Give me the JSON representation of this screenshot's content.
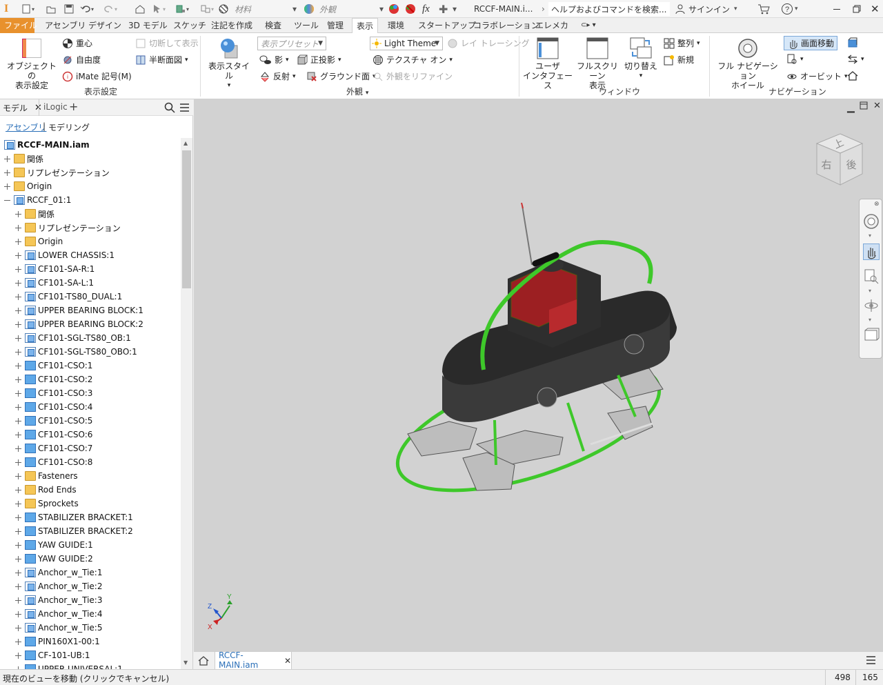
{
  "titlebar": {
    "materials_label": "材料",
    "appearance_label": "外観",
    "document_title": "RCCF-MAIN.i...",
    "search_placeholder": "ヘルプおよびコマンドを検索...",
    "signin_label": "サインイン"
  },
  "ribbon_tabs": [
    "ファイル",
    "アセンブリ",
    "デザイン",
    "3D モデル",
    "スケッチ",
    "注記を作成",
    "検査",
    "ツール",
    "管理",
    "表示",
    "環境",
    "スタートアップ",
    "コラボレーション",
    "エレメカ"
  ],
  "ribbon": {
    "object_visibility": "オブジェクトの\n表示設定",
    "center_of_gravity": "重心",
    "dof": "自由度",
    "imate_glyph": "iMate 記号(M)",
    "visibility_group": "表示設定",
    "cut_display": "切断して表示",
    "half_section": "半断面図",
    "visual_style": "表示スタイル",
    "view_preset": "表示プリセット",
    "light_theme": "Light Theme",
    "ray_tracing": "レイ トレーシング",
    "shadow": "影",
    "orthographic": "正投影",
    "texture_on": "テクスチャ オン",
    "reflection": "反射",
    "ground_plane": "グラウンド面",
    "refine_appearance": "外観をリファイン",
    "appearance_group": "外観",
    "user_interface": "ユーザ\nインタフェース",
    "full_screen": "フルスクリーン\n表示",
    "switch": "切り替え",
    "arrange": "整列",
    "new_window": "新規",
    "window_group": "ウィンドウ",
    "full_nav_wheel": "フル ナビゲーション\nホイール",
    "pan": "画面移動",
    "orbit": "オービット",
    "navigation_group": "ナビゲーション"
  },
  "browser": {
    "tab_model": "モデル",
    "tab_ilogic": "iLogic",
    "sub_assembly": "アセンブリ",
    "sub_modeling": "モデリング",
    "root": "RCCF-MAIN.iam",
    "items": [
      {
        "label": "関係",
        "icon": "folder",
        "indent": 0,
        "exp": "plus"
      },
      {
        "label": "リプレゼンテーション",
        "icon": "folder",
        "indent": 0,
        "exp": "plus"
      },
      {
        "label": "Origin",
        "icon": "folder",
        "indent": 0,
        "exp": "plus"
      },
      {
        "label": "RCCF_01:1",
        "icon": "asm",
        "indent": 0,
        "exp": "minus"
      },
      {
        "label": "関係",
        "icon": "folder",
        "indent": 1,
        "exp": "plus"
      },
      {
        "label": "リプレゼンテーション",
        "icon": "folder",
        "indent": 1,
        "exp": "plus"
      },
      {
        "label": "Origin",
        "icon": "folder",
        "indent": 1,
        "exp": "plus"
      },
      {
        "label": "LOWER CHASSIS:1",
        "icon": "asm",
        "indent": 1,
        "exp": "plus"
      },
      {
        "label": "CF101-SA-R:1",
        "icon": "asm",
        "indent": 1,
        "exp": "plus"
      },
      {
        "label": "CF101-SA-L:1",
        "icon": "asm",
        "indent": 1,
        "exp": "plus"
      },
      {
        "label": "CF101-TS80_DUAL:1",
        "icon": "asm",
        "indent": 1,
        "exp": "plus"
      },
      {
        "label": "UPPER BEARING BLOCK:1",
        "icon": "asm",
        "indent": 1,
        "exp": "plus"
      },
      {
        "label": "UPPER BEARING BLOCK:2",
        "icon": "asm",
        "indent": 1,
        "exp": "plus"
      },
      {
        "label": "CF101-SGL-TS80_OB:1",
        "icon": "asm",
        "indent": 1,
        "exp": "plus"
      },
      {
        "label": "CF101-SGL-TS80_OBO:1",
        "icon": "asm",
        "indent": 1,
        "exp": "plus"
      },
      {
        "label": "CF101-CSO:1",
        "icon": "part",
        "indent": 1,
        "exp": "plus"
      },
      {
        "label": "CF101-CSO:2",
        "icon": "part",
        "indent": 1,
        "exp": "plus"
      },
      {
        "label": "CF101-CSO:3",
        "icon": "part",
        "indent": 1,
        "exp": "plus"
      },
      {
        "label": "CF101-CSO:4",
        "icon": "part",
        "indent": 1,
        "exp": "plus"
      },
      {
        "label": "CF101-CSO:5",
        "icon": "part",
        "indent": 1,
        "exp": "plus"
      },
      {
        "label": "CF101-CSO:6",
        "icon": "part",
        "indent": 1,
        "exp": "plus"
      },
      {
        "label": "CF101-CSO:7",
        "icon": "part",
        "indent": 1,
        "exp": "plus"
      },
      {
        "label": "CF101-CSO:8",
        "icon": "part",
        "indent": 1,
        "exp": "plus"
      },
      {
        "label": "Fasteners",
        "icon": "folder",
        "indent": 1,
        "exp": "plus"
      },
      {
        "label": "Rod Ends",
        "icon": "folder",
        "indent": 1,
        "exp": "plus"
      },
      {
        "label": "Sprockets",
        "icon": "folder",
        "indent": 1,
        "exp": "plus"
      },
      {
        "label": "STABILIZER BRACKET:1",
        "icon": "part",
        "indent": 1,
        "exp": "plus"
      },
      {
        "label": "STABILIZER BRACKET:2",
        "icon": "part",
        "indent": 1,
        "exp": "plus"
      },
      {
        "label": "YAW GUIDE:1",
        "icon": "part",
        "indent": 1,
        "exp": "plus"
      },
      {
        "label": "YAW GUIDE:2",
        "icon": "part",
        "indent": 1,
        "exp": "plus"
      },
      {
        "label": "Anchor_w_Tie:1",
        "icon": "asm",
        "indent": 1,
        "exp": "plus"
      },
      {
        "label": "Anchor_w_Tie:2",
        "icon": "asm",
        "indent": 1,
        "exp": "plus"
      },
      {
        "label": "Anchor_w_Tie:3",
        "icon": "asm",
        "indent": 1,
        "exp": "plus"
      },
      {
        "label": "Anchor_w_Tie:4",
        "icon": "asm",
        "indent": 1,
        "exp": "plus"
      },
      {
        "label": "Anchor_w_Tie:5",
        "icon": "asm",
        "indent": 1,
        "exp": "plus"
      },
      {
        "label": "PIN160X1-00:1",
        "icon": "part",
        "indent": 1,
        "exp": "plus"
      },
      {
        "label": "CF-101-UB:1",
        "icon": "part",
        "indent": 1,
        "exp": "plus"
      },
      {
        "label": "UPPER UNIVERSAL:1",
        "icon": "part",
        "indent": 1,
        "exp": "plus"
      }
    ]
  },
  "viewcube": {
    "top": "上",
    "right": "右",
    "back": "後"
  },
  "triad": {
    "x": "X",
    "y": "Y",
    "z": "Z"
  },
  "doc_tab": "RCCF-MAIN.iam",
  "status": {
    "message": "現在のビューを移動 (クリックでキャンセル)",
    "x": "498",
    "y": "165"
  },
  "colors": {
    "accent": "#e8912d",
    "green": "#3ec82a",
    "body": "#2e2e2e",
    "engine": "#9c1f22",
    "viewport": "#d2d2d2"
  }
}
